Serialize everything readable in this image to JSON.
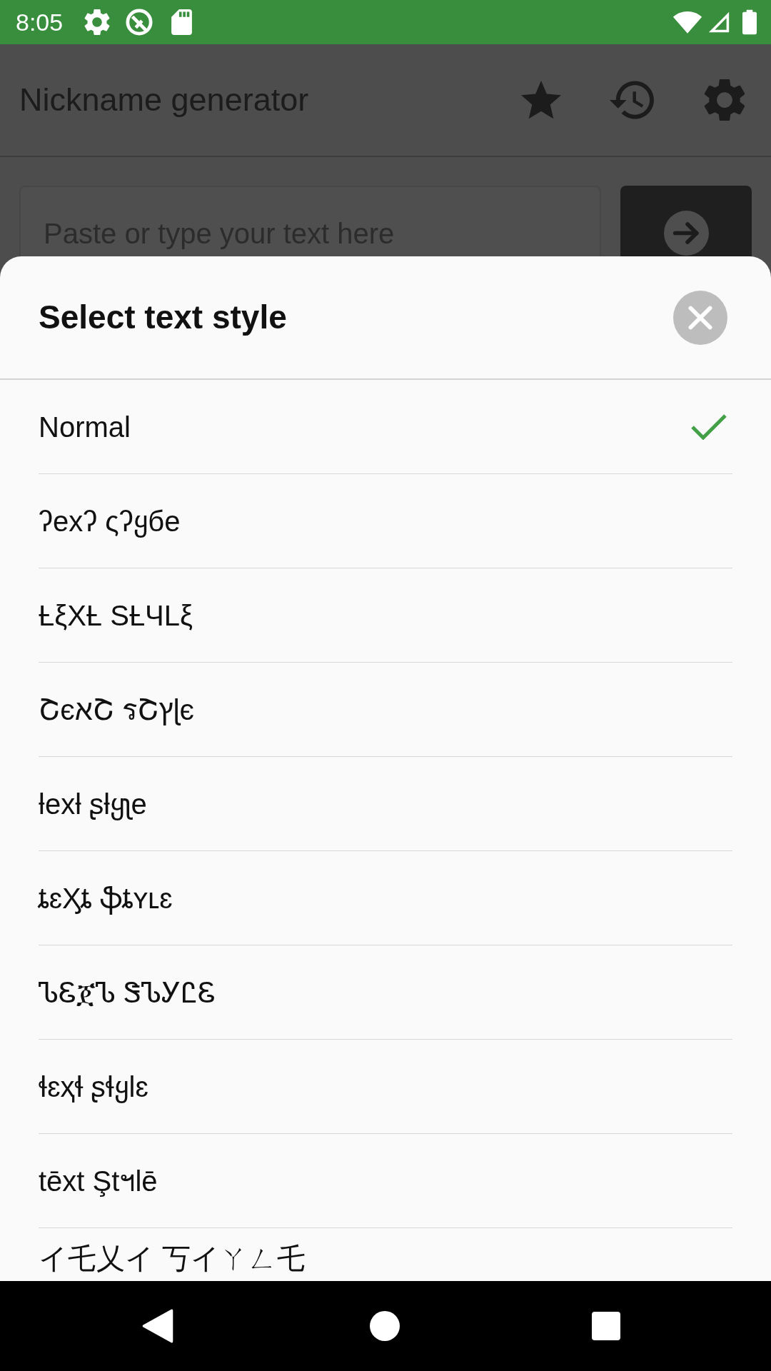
{
  "status_bar": {
    "time": "8:05"
  },
  "app_bar": {
    "title": "Nickname generator"
  },
  "input": {
    "placeholder": "Paste or type your text here"
  },
  "style_sheet": {
    "title": "Select text style",
    "styles": [
      {
        "label": "Normal",
        "selected": true
      },
      {
        "label": "ʔexʔ ςʔყбe",
        "selected": false
      },
      {
        "label": "ȽξXȽ SȽЧLξ",
        "selected": false
      },
      {
        "label": "ՇєאՇ รՇץɭє",
        "selected": false
      },
      {
        "label": "ƚexƚ ʂƚყʅe",
        "selected": false
      },
      {
        "label": "ȶɛӼȶ ֆȶʏʟɛ",
        "selected": false
      },
      {
        "label": "ᏖᏋጀᏖ ᏕᏖᎩᏝᏋ",
        "selected": false
      },
      {
        "label": "ɬɛҳɬ ʂɬყlɛ",
        "selected": false
      },
      {
        "label": "tēxt Ştฯlē",
        "selected": false
      },
      {
        "label": "イ乇乂イ 丂イㄚㄥ乇",
        "selected": false
      }
    ]
  }
}
